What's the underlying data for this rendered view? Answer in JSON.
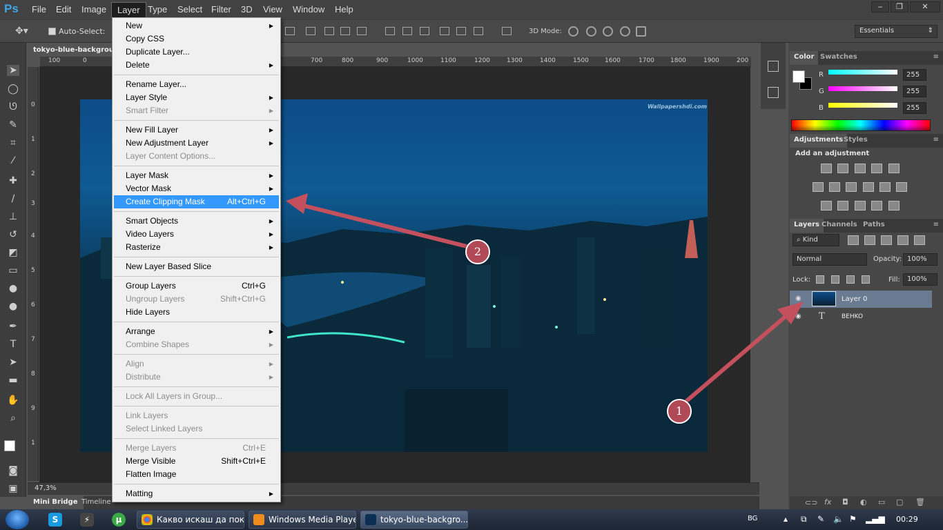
{
  "app": {
    "logo": "Ps"
  },
  "menubar": {
    "items": [
      "File",
      "Edit",
      "Image",
      "Layer",
      "Type",
      "Select",
      "Filter",
      "3D",
      "View",
      "Window",
      "Help"
    ]
  },
  "window_controls": [
    "‒",
    "❐",
    "✕"
  ],
  "options_bar": {
    "auto_select_label": "Auto-Select:",
    "mode_3d_label": "3D Mode:",
    "workspace": "Essentials"
  },
  "document": {
    "tab_title": "tokyo-blue-backgrou",
    "zoom": "47,3%",
    "watermark": "Wallpapershdi.com"
  },
  "rulers": {
    "horizontal": [
      "100",
      "0",
      "700",
      "800",
      "900",
      "1000",
      "1100",
      "1200",
      "1300",
      "1400",
      "1500",
      "1600",
      "1700",
      "1800",
      "1900",
      "200"
    ],
    "vertical": [
      "0",
      "1",
      "2",
      "3",
      "4",
      "5",
      "6",
      "7",
      "8",
      "9",
      "1"
    ]
  },
  "bottom_tabs": [
    "Mini Bridge",
    "Timeline"
  ],
  "layer_menu": {
    "items": [
      {
        "label": "New",
        "sub": true
      },
      {
        "label": "Copy CSS"
      },
      {
        "label": "Duplicate Layer..."
      },
      {
        "label": "Delete",
        "sub": true
      },
      {
        "sep": true
      },
      {
        "label": "Rename Layer..."
      },
      {
        "label": "Layer Style",
        "sub": true
      },
      {
        "label": "Smart Filter",
        "sub": true,
        "disabled": true
      },
      {
        "sep": true
      },
      {
        "label": "New Fill Layer",
        "sub": true
      },
      {
        "label": "New Adjustment Layer",
        "sub": true
      },
      {
        "label": "Layer Content Options...",
        "disabled": true
      },
      {
        "sep": true
      },
      {
        "label": "Layer Mask",
        "sub": true
      },
      {
        "label": "Vector Mask",
        "sub": true
      },
      {
        "label": "Create Clipping Mask",
        "shortcut": "Alt+Ctrl+G",
        "highlighted": true
      },
      {
        "sep": true
      },
      {
        "label": "Smart Objects",
        "sub": true
      },
      {
        "label": "Video Layers",
        "sub": true
      },
      {
        "label": "Rasterize",
        "sub": true
      },
      {
        "sep": true
      },
      {
        "label": "New Layer Based Slice"
      },
      {
        "sep": true
      },
      {
        "label": "Group Layers",
        "shortcut": "Ctrl+G"
      },
      {
        "label": "Ungroup Layers",
        "shortcut": "Shift+Ctrl+G",
        "disabled": true
      },
      {
        "label": "Hide Layers"
      },
      {
        "sep": true
      },
      {
        "label": "Arrange",
        "sub": true
      },
      {
        "label": "Combine Shapes",
        "sub": true,
        "disabled": true
      },
      {
        "sep": true
      },
      {
        "label": "Align",
        "sub": true,
        "disabled": true
      },
      {
        "label": "Distribute",
        "sub": true,
        "disabled": true
      },
      {
        "sep": true
      },
      {
        "label": "Lock All Layers in Group...",
        "disabled": true
      },
      {
        "sep": true
      },
      {
        "label": "Link Layers",
        "disabled": true
      },
      {
        "label": "Select Linked Layers",
        "disabled": true
      },
      {
        "sep": true
      },
      {
        "label": "Merge Layers",
        "shortcut": "Ctrl+E",
        "disabled": true
      },
      {
        "label": "Merge Visible",
        "shortcut": "Shift+Ctrl+E"
      },
      {
        "label": "Flatten Image"
      },
      {
        "sep": true
      },
      {
        "label": "Matting",
        "sub": true
      }
    ]
  },
  "color_panel": {
    "tabs": [
      "Color",
      "Swatches"
    ],
    "channels": [
      {
        "label": "R",
        "value": "255",
        "color": "#00ffff"
      },
      {
        "label": "G",
        "value": "255",
        "color": "#ff00ff"
      },
      {
        "label": "B",
        "value": "255",
        "color": "#ffff00"
      }
    ]
  },
  "adjustments_panel": {
    "tabs": [
      "Adjustments",
      "Styles"
    ],
    "heading": "Add an adjustment"
  },
  "layers_panel": {
    "tabs": [
      "Layers",
      "Channels",
      "Paths"
    ],
    "filter": "Kind",
    "blend_mode": "Normal",
    "opacity_label": "Opacity:",
    "opacity": "100%",
    "lock_label": "Lock:",
    "fill_label": "Fill:",
    "fill": "100%",
    "layers": [
      {
        "name": "Layer 0",
        "selected": true
      },
      {
        "name": "BEHKO",
        "type_icon": "T"
      }
    ]
  },
  "taskbar": {
    "tasks": [
      "Какво искаш да пок...",
      "Windows Media Player",
      "tokyo-blue-backgro..."
    ],
    "lang": "BG",
    "clock": "00:29"
  },
  "annotations": {
    "badge_1": "1",
    "badge_2": "2",
    "color": "#c4505d"
  }
}
